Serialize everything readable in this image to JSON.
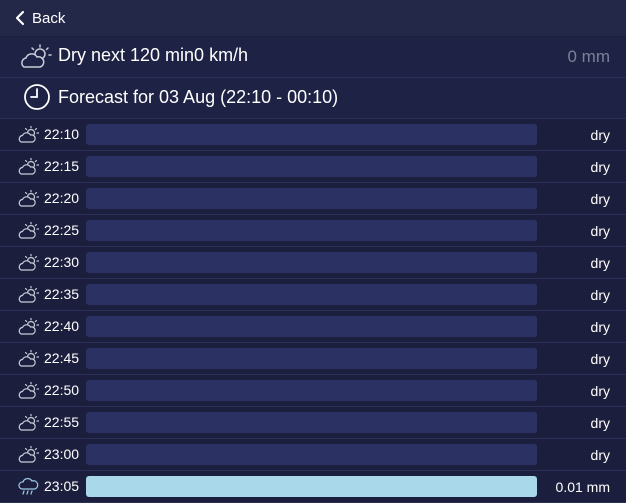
{
  "nav": {
    "back_label": "Back"
  },
  "summary": {
    "text": "Dry next 120 min0 km/h",
    "amount": "0 mm"
  },
  "forecast": {
    "title": "Forecast for 03 Aug (22:10 - 00:10)"
  },
  "colors": {
    "dry_bar": "#2b3163",
    "rain_bar": "#a8d8ea",
    "background": "#1b1f3d"
  },
  "rows": [
    {
      "time": "22:10",
      "value": "dry",
      "icon": "partly-cloudy-night-icon"
    },
    {
      "time": "22:15",
      "value": "dry",
      "icon": "partly-cloudy-night-icon"
    },
    {
      "time": "22:20",
      "value": "dry",
      "icon": "partly-cloudy-night-icon"
    },
    {
      "time": "22:25",
      "value": "dry",
      "icon": "partly-cloudy-night-icon"
    },
    {
      "time": "22:30",
      "value": "dry",
      "icon": "partly-cloudy-night-icon"
    },
    {
      "time": "22:35",
      "value": "dry",
      "icon": "partly-cloudy-night-icon"
    },
    {
      "time": "22:40",
      "value": "dry",
      "icon": "partly-cloudy-night-icon"
    },
    {
      "time": "22:45",
      "value": "dry",
      "icon": "partly-cloudy-night-icon"
    },
    {
      "time": "22:50",
      "value": "dry",
      "icon": "partly-cloudy-night-icon"
    },
    {
      "time": "22:55",
      "value": "dry",
      "icon": "partly-cloudy-night-icon"
    },
    {
      "time": "23:00",
      "value": "dry",
      "icon": "partly-cloudy-night-icon"
    },
    {
      "time": "23:05",
      "value": "0.01 mm",
      "icon": "rain-cloud-icon"
    }
  ]
}
